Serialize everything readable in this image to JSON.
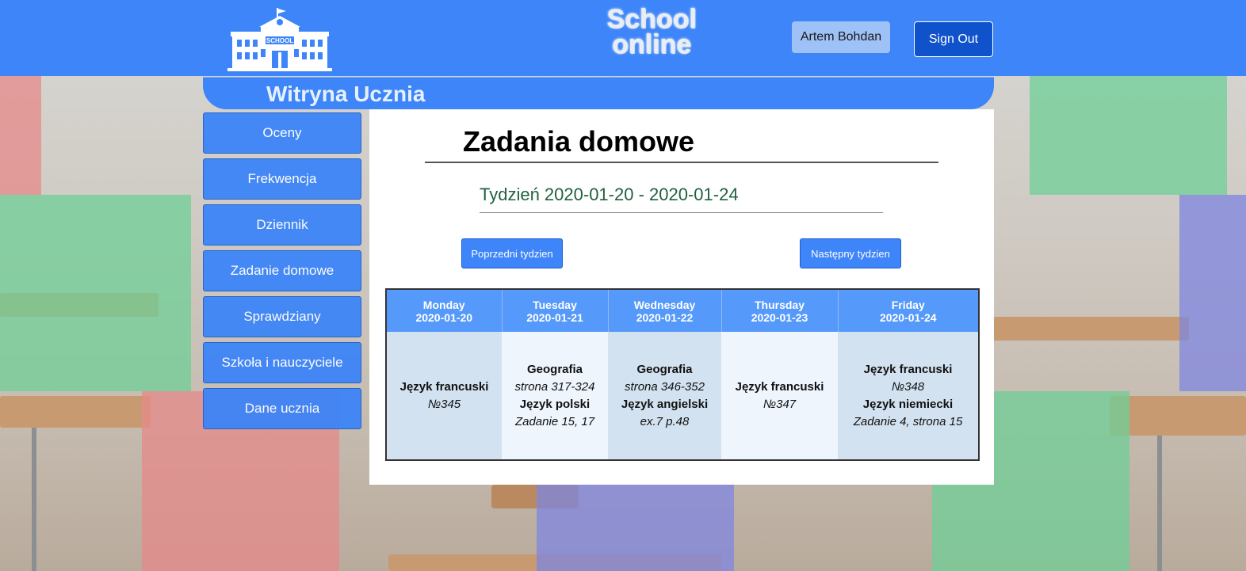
{
  "header": {
    "logo_text": "SCHOOL",
    "brand_line1": "School",
    "brand_line2": "online",
    "user_name": "Artem Bohdan",
    "signout_label": "Sign Out"
  },
  "portal": {
    "title": "Witryna Ucznia"
  },
  "sidebar": {
    "items": [
      {
        "label": "Oceny"
      },
      {
        "label": "Frekwencja"
      },
      {
        "label": "Dziennik"
      },
      {
        "label": "Zadanie domowe"
      },
      {
        "label": "Sprawdziany"
      },
      {
        "label": "Szkoła i nauczyciele"
      },
      {
        "label": "Dane ucznia"
      }
    ]
  },
  "main": {
    "title": "Zadania domowe",
    "week_label": "Tydzień 2020-01-20 - 2020-01-24",
    "prev_label": "Poprzedni tydzien",
    "next_label": "Następny tydzien"
  },
  "table": {
    "days": [
      {
        "day": "Monday",
        "date": "2020-01-20",
        "entries": [
          {
            "subject": "Język francuski",
            "task": "№345"
          }
        ]
      },
      {
        "day": "Tuesday",
        "date": "2020-01-21",
        "entries": [
          {
            "subject": "Geografia",
            "task": "strona 317-324"
          },
          {
            "subject": "Język polski",
            "task": "Zadanie 15, 17"
          }
        ]
      },
      {
        "day": "Wednesday",
        "date": "2020-01-22",
        "entries": [
          {
            "subject": "Geografia",
            "task": "strona 346-352"
          },
          {
            "subject": "Język angielski",
            "task": "ex.7 p.48"
          }
        ]
      },
      {
        "day": "Thursday",
        "date": "2020-01-23",
        "entries": [
          {
            "subject": "Język francuski",
            "task": "№347"
          }
        ]
      },
      {
        "day": "Friday",
        "date": "2020-01-24",
        "entries": [
          {
            "subject": "Język francuski",
            "task": "№348"
          },
          {
            "subject": "Język niemiecki",
            "task": "Zadanie 4, strona 15"
          }
        ]
      }
    ]
  },
  "colors": {
    "header_blue": "#3d85f8",
    "signout_blue": "#0f52cc",
    "week_green": "#216040"
  }
}
